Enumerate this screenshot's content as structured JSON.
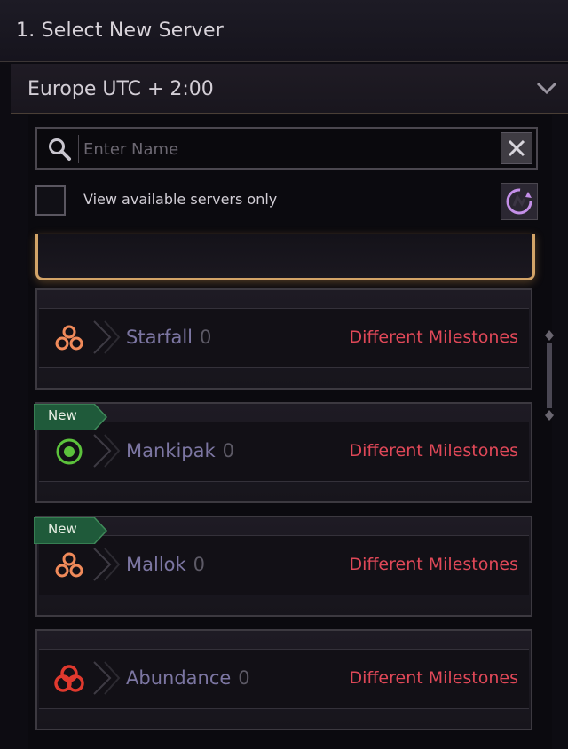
{
  "header": {
    "title": "1. Select New Server"
  },
  "region": {
    "label": "Europe UTC + 2:00",
    "icon": "chevron-down-icon"
  },
  "search": {
    "placeholder": "Enter Name",
    "value": ""
  },
  "filter": {
    "label": "View available servers only",
    "checked": false
  },
  "servers": [
    {
      "name": "Starfall",
      "count": "0",
      "status": "Different Milestones",
      "badge": "",
      "icon": "trefoil-icon",
      "icon_color": "#f08a5a"
    },
    {
      "name": "Mankipak",
      "count": "0",
      "status": "Different Milestones",
      "badge": "New",
      "icon": "target-icon",
      "icon_color": "#5cc23c"
    },
    {
      "name": "Mallok",
      "count": "0",
      "status": "Different Milestones",
      "badge": "New",
      "icon": "trefoil-icon",
      "icon_color": "#f08a5a"
    },
    {
      "name": "Abundance",
      "count": "0",
      "status": "Different Milestones",
      "badge": "",
      "icon": "knot-icon",
      "icon_color": "#e0392e"
    }
  ],
  "colors": {
    "status_red": "#e04858",
    "server_name": "#7c76a2",
    "selected_border": "#d3a468",
    "badge_green": "#1f5a3a"
  }
}
